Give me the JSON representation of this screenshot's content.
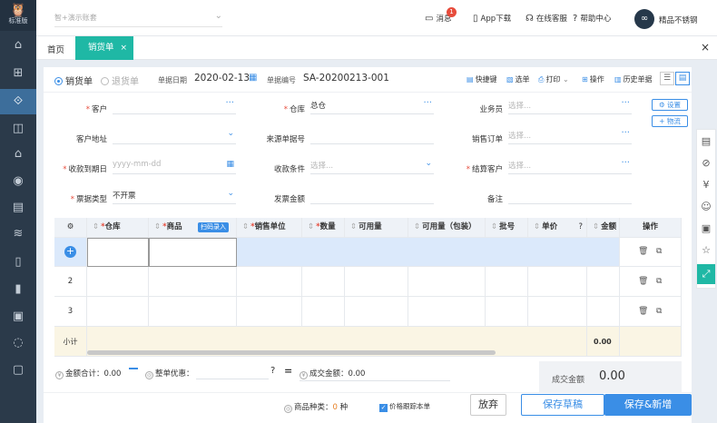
{
  "sidebar": {
    "logo_glyph": "🦉",
    "edition": "标准版",
    "items": [
      {
        "icon": "home-icon",
        "glyph": "⌂"
      },
      {
        "icon": "gift-icon",
        "glyph": "⊞"
      },
      {
        "icon": "sales-icon",
        "glyph": "⟐",
        "active": true
      },
      {
        "icon": "bag-icon",
        "glyph": "◫"
      },
      {
        "icon": "warehouse-icon",
        "glyph": "⌂"
      },
      {
        "icon": "money-bag-icon",
        "glyph": "◉"
      },
      {
        "icon": "report-icon",
        "glyph": "▤"
      },
      {
        "icon": "stack-icon",
        "glyph": "≋"
      },
      {
        "icon": "document-icon",
        "glyph": "▯"
      },
      {
        "icon": "clipboard-icon",
        "glyph": "▮"
      },
      {
        "icon": "data-board-icon",
        "glyph": "▣"
      },
      {
        "icon": "loop-icon",
        "glyph": "◌"
      },
      {
        "icon": "settings-box-icon",
        "glyph": "▢"
      }
    ]
  },
  "topbar": {
    "account": "智+演示账套",
    "messages": "消息",
    "message_count": "1",
    "app_download": "App下载",
    "online_service": "在线客服",
    "help_center": "帮助中心",
    "user_name": "精品不锈钢",
    "avatar_glyph": "∞"
  },
  "tabs": {
    "home": "首页",
    "sales_order": "销货单",
    "close": "×",
    "page_close": "×"
  },
  "toolbar": {
    "radio_sales": "销货单",
    "radio_return": "退货单",
    "date_label": "单据日期",
    "date_value": "2020-02-13",
    "number_label": "单据编号",
    "number_value": "SA-20200213-001",
    "actions": [
      "快捷键",
      "选单",
      "打印",
      "操作",
      "历史单据"
    ]
  },
  "form": {
    "customer_label": "客户",
    "warehouse_label": "仓库",
    "warehouse_value": "总仓",
    "salesman_label": "业务员",
    "salesman_placeholder": "选择...",
    "settings_button": "设置",
    "logistics_button": "物流",
    "address_label": "客户地址",
    "source_label": "来源单据号",
    "sales_order_label": "销售订单",
    "sales_order_placeholder": "选择...",
    "due_label": "收款到期日",
    "due_placeholder": "yyyy-mm-dd",
    "terms_label": "收款条件",
    "terms_placeholder": "选择...",
    "settle_label": "结算客户",
    "settle_placeholder": "选择...",
    "invoice_type_label": "票据类型",
    "invoice_type_value": "不开票",
    "invoice_amount_label": "发票金额",
    "remark_label": "备注"
  },
  "grid": {
    "headers": {
      "warehouse": "仓库",
      "product": "商品",
      "scan": "扫码录入",
      "unit": "销售单位",
      "quantity": "数量",
      "available": "可用量",
      "available_pack": "可用量（包装）",
      "batch": "批号",
      "price": "单价",
      "amount": "金额",
      "operation": "操作"
    },
    "rows": [
      "2",
      "3"
    ],
    "subtotal_label": "小计",
    "subtotal_amount": "0.00"
  },
  "footer": {
    "amount_total": "金额合计：0.00",
    "discount": "整单优惠：",
    "deal_amount": "成交金额：0.00",
    "total_label": "成交金额",
    "total_value": "0.00",
    "product_kinds_label": "商品种类：",
    "product_kinds_value": "0",
    "product_kinds_unit": "种",
    "price_track_label": "价格跟踪本单",
    "abandon": "放弃",
    "save_draft": "保存草稿",
    "save_new": "保存&新增"
  },
  "colors": {
    "accent_teal": "#1fb8a5",
    "primary_blue": "#3a8ee6",
    "sidebar_bg": "#2b3a4a"
  }
}
